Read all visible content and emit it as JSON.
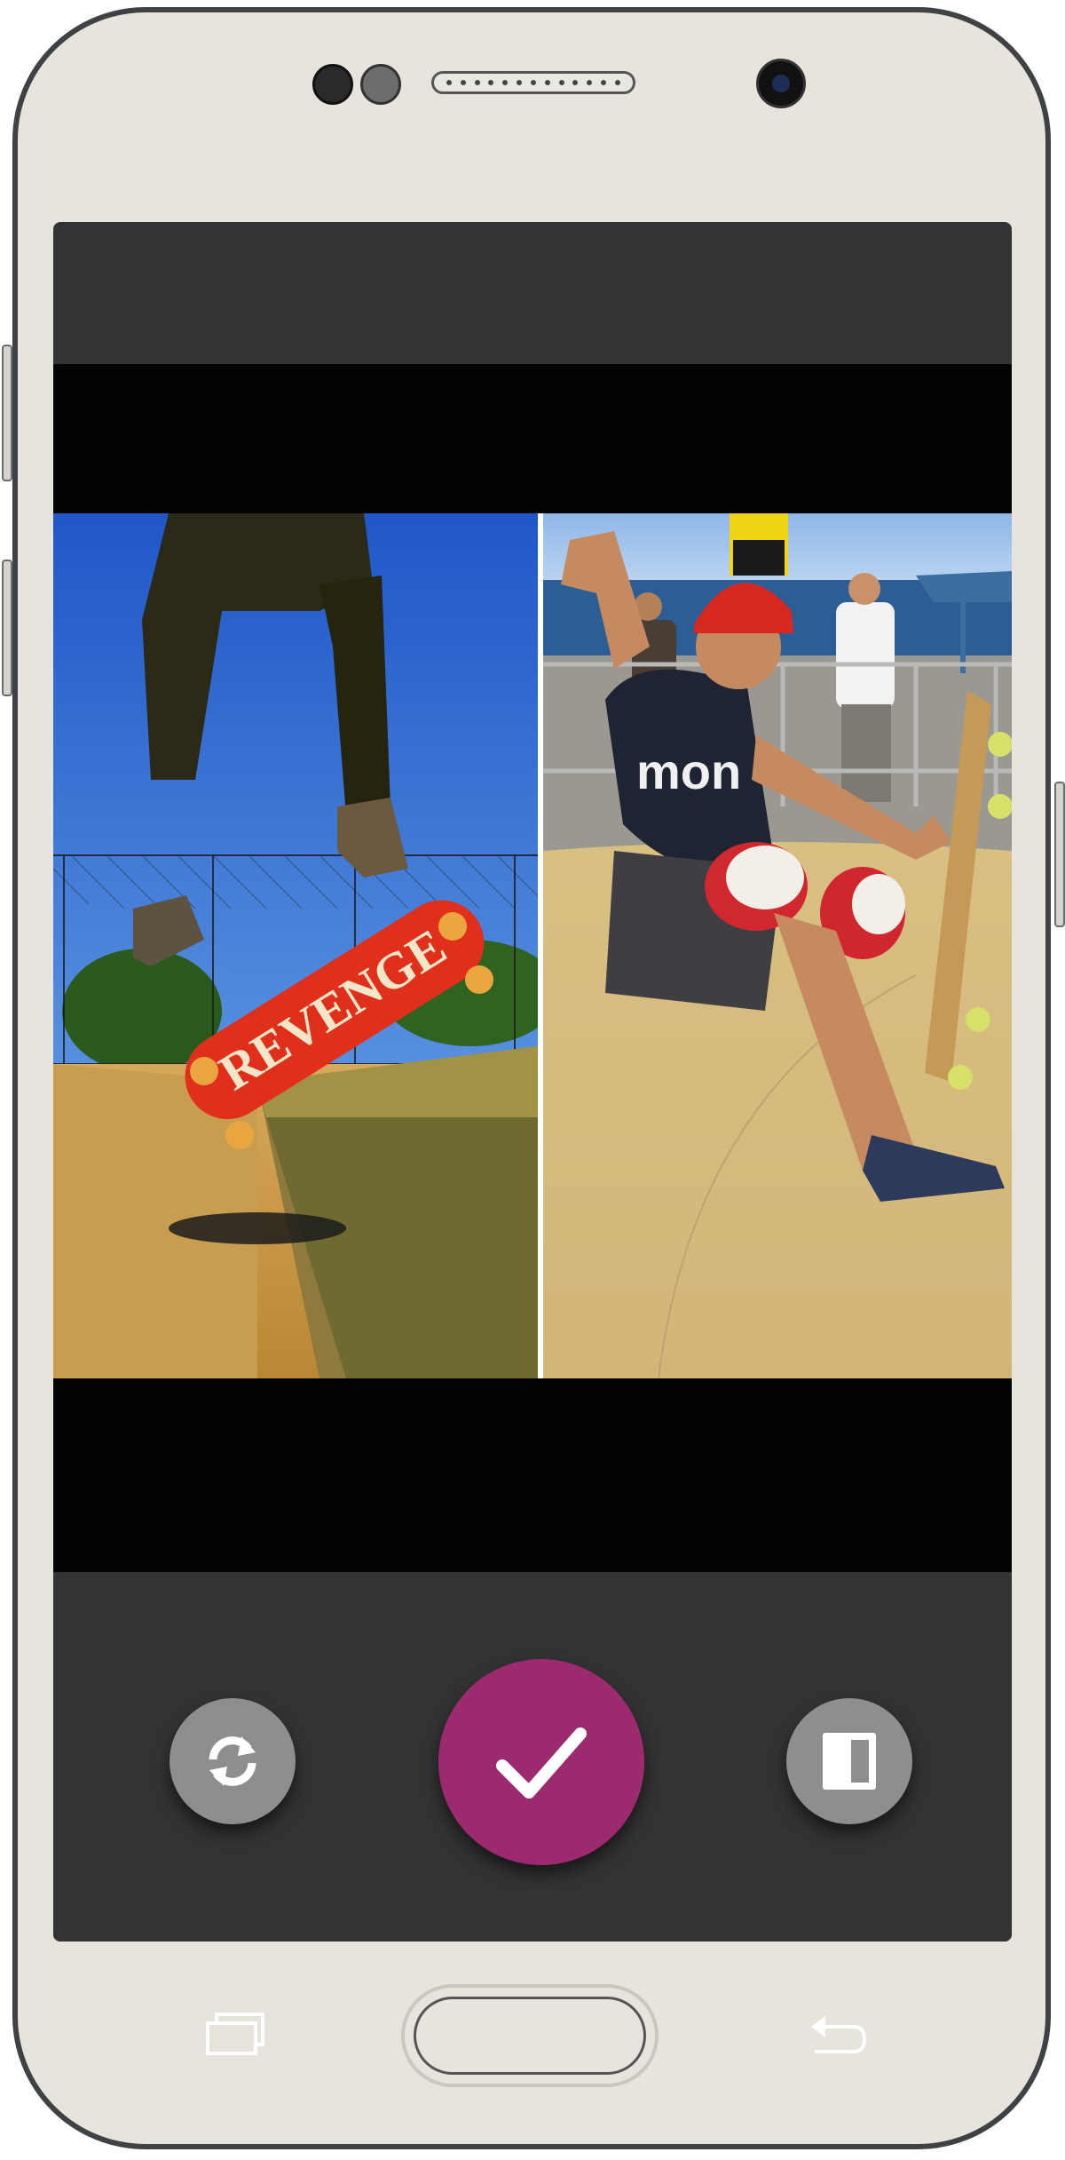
{
  "device": {
    "colors": {
      "body": "#e7e4dd",
      "bezel": "#3f4245",
      "screen_bg": "#333333",
      "preview_bg": "#030303",
      "accent": "#9c2a6e",
      "button_grey": "#8e8e8e"
    }
  },
  "collage": {
    "left_photo": {
      "icon": "skateboard-photo"
    },
    "right_photo": {
      "icon": "skater-ramp-photo"
    }
  },
  "toolbar": {
    "swap_button": {
      "icon": "refresh-icon"
    },
    "confirm_button": {
      "icon": "checkmark-icon"
    },
    "layout_button": {
      "icon": "layout-split-icon"
    }
  },
  "system_nav": {
    "recents": {
      "icon": "recents-icon"
    },
    "home": {
      "icon": "home-button"
    },
    "back": {
      "icon": "back-icon"
    }
  }
}
